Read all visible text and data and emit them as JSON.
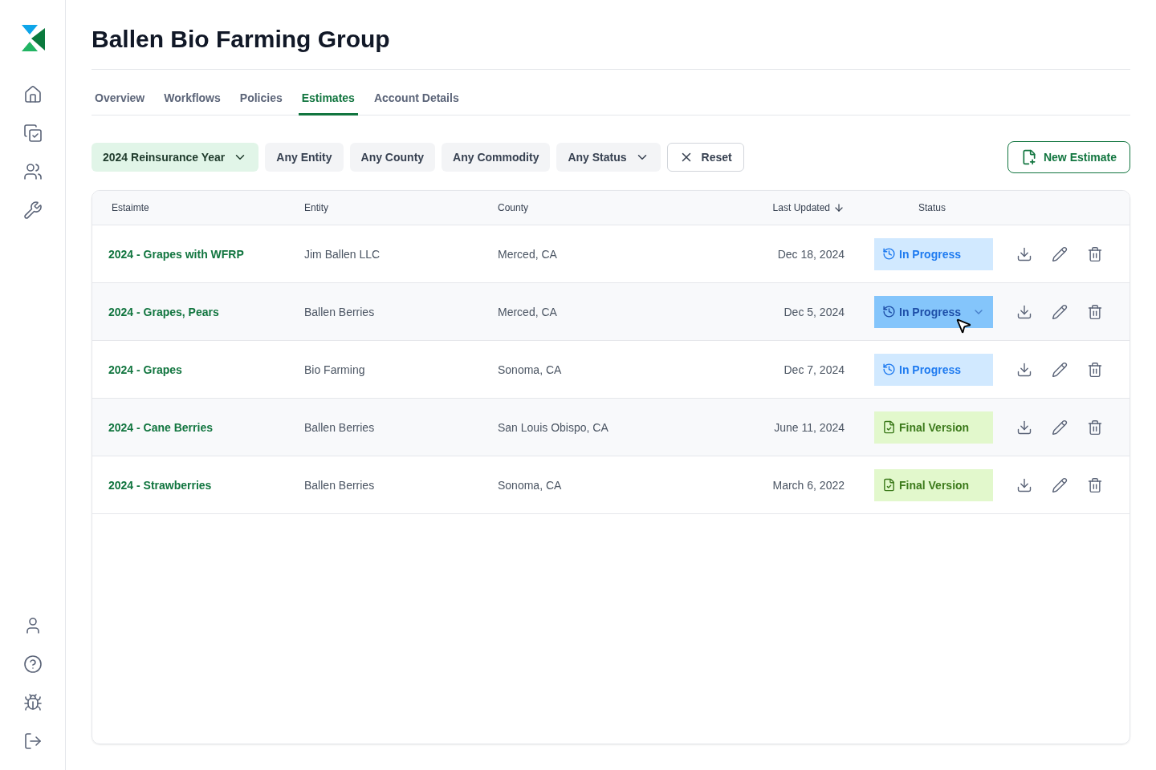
{
  "title": "Ballen Bio Farming Group",
  "tabs": [
    {
      "label": "Overview",
      "selected": false
    },
    {
      "label": "Workflows",
      "selected": false
    },
    {
      "label": "Policies",
      "selected": false
    },
    {
      "label": "Estimates",
      "selected": true
    },
    {
      "label": "Account Details",
      "selected": false
    }
  ],
  "filters": [
    {
      "label": "2024 Reinsurance Year",
      "active": true,
      "dropdown": true
    },
    {
      "label": "Any Entity",
      "active": false,
      "dropdown": false
    },
    {
      "label": "Any County",
      "active": false,
      "dropdown": false
    },
    {
      "label": "Any Commodity",
      "active": false,
      "dropdown": false
    },
    {
      "label": "Any Status",
      "active": false,
      "dropdown": true
    }
  ],
  "reset_button": "Reset",
  "new_button": "New Estimate",
  "table": {
    "columns": [
      "Estaimte",
      "Entity",
      "County",
      "Last Updated",
      "Status"
    ],
    "rows": [
      {
        "estimate": "2024 - Grapes with WFRP",
        "entity": "Jim Ballen LLC",
        "county": "Merced, CA",
        "updated": "Dec 18, 2024",
        "status": "In Progress",
        "kind": "in_progress",
        "hovered": false
      },
      {
        "estimate": "2024 - Grapes, Pears",
        "entity": "Ballen Berries",
        "county": "Merced, CA",
        "updated": "Dec 5, 2024",
        "status": "In Progress",
        "kind": "in_progress",
        "hovered": true
      },
      {
        "estimate": "2024 - Grapes",
        "entity": "Bio Farming",
        "county": "Sonoma, CA",
        "updated": "Dec 7, 2024",
        "status": "In Progress",
        "kind": "in_progress",
        "hovered": false
      },
      {
        "estimate": "2024 - Cane Berries",
        "entity": "Ballen Berries",
        "county": "San Louis Obispo, CA",
        "updated": "June 11, 2024",
        "status": "Final Version",
        "kind": "final",
        "hovered": false
      },
      {
        "estimate": "2024 - Strawberries",
        "entity": "Ballen Berries",
        "county": "Sonoma, CA",
        "updated": "March 6, 2022",
        "status": "Final Version",
        "kind": "final",
        "hovered": false
      }
    ]
  }
}
